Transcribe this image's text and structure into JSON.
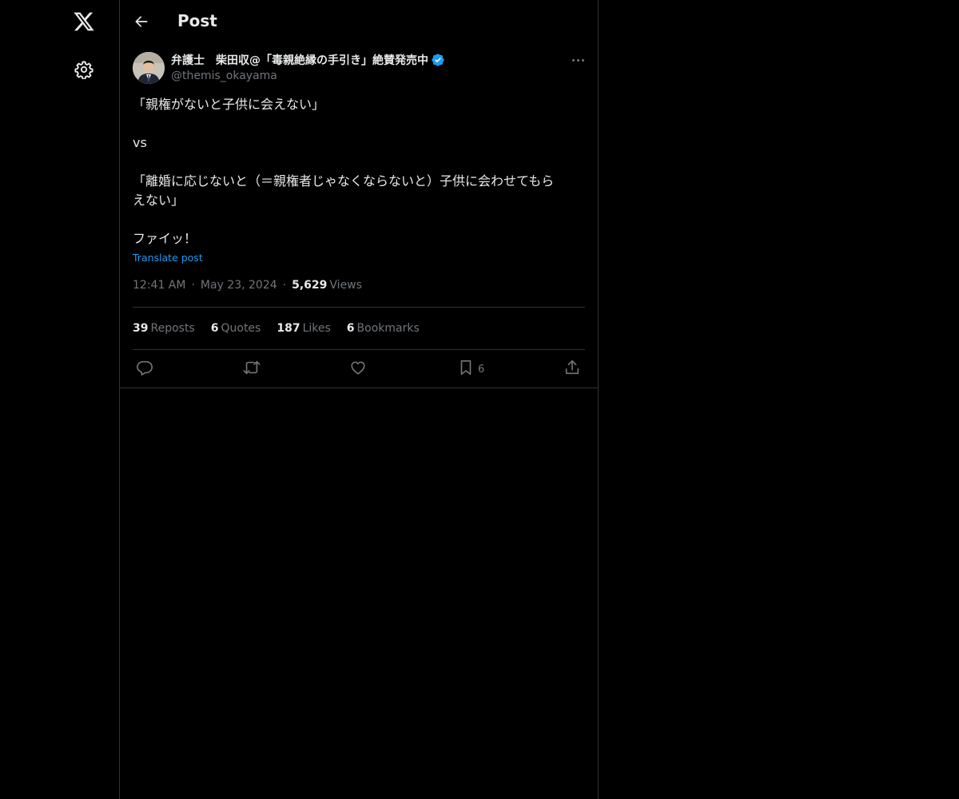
{
  "nav": {
    "logo_icon": "x-logo-icon",
    "settings_icon": "gear-icon"
  },
  "header": {
    "title": "Post"
  },
  "post": {
    "author": {
      "name": "弁護士　柴田収@「毒親絶縁の手引き」絶賛発売中",
      "handle": "@themis_okayama",
      "verified": true
    },
    "text_lines": [
      "「親権がないと子供に会えない」",
      "",
      "vs",
      "",
      "「離婚に応じないと（＝親権者じゃなくならないと）子供に会わせてもら",
      "えない」",
      "",
      "ファイッ！"
    ],
    "translate_label": "Translate post",
    "time": "12:41 AM",
    "date": "May 23, 2024",
    "views_count": "5,629",
    "views_label": "Views",
    "stats": {
      "reposts_count": "39",
      "reposts_label": "Reposts",
      "quotes_count": "6",
      "quotes_label": "Quotes",
      "likes_count": "187",
      "likes_label": "Likes",
      "bookmarks_count": "6",
      "bookmarks_label": "Bookmarks"
    },
    "actions": {
      "bookmark_count": "6"
    }
  },
  "colors": {
    "background": "#000000",
    "text": "#e7e9ea",
    "muted": "#71767b",
    "border": "#2f3336",
    "accent": "#1d9bf0"
  }
}
